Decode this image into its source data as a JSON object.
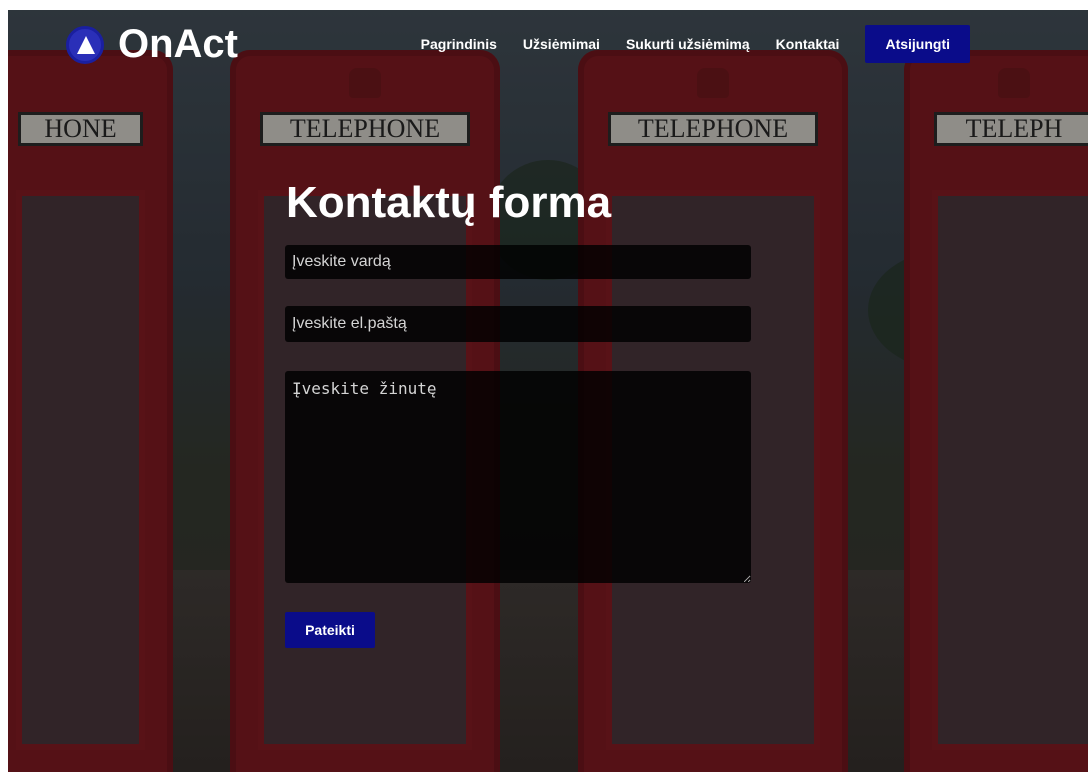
{
  "brand": {
    "name": "OnAct",
    "logo_color": "#2a2fb8"
  },
  "nav": {
    "items": [
      {
        "label": "Pagrindinis"
      },
      {
        "label": "Užsiėmimai"
      },
      {
        "label": "Sukurti užsiėmimą"
      },
      {
        "label": "Kontaktai"
      }
    ],
    "logout_label": "Atsijungti",
    "accent": "#0a0c8a"
  },
  "form": {
    "title": "Kontaktų forma",
    "name_placeholder": "Įveskite vardą",
    "email_placeholder": "Įveskite el.paštą",
    "message_placeholder": "Įveskite žinutę",
    "submit_label": "Pateikti"
  },
  "background": {
    "booth_signs": [
      "HONE",
      "TELEPHONE",
      "TELEPHONE",
      "TELEPH"
    ]
  }
}
